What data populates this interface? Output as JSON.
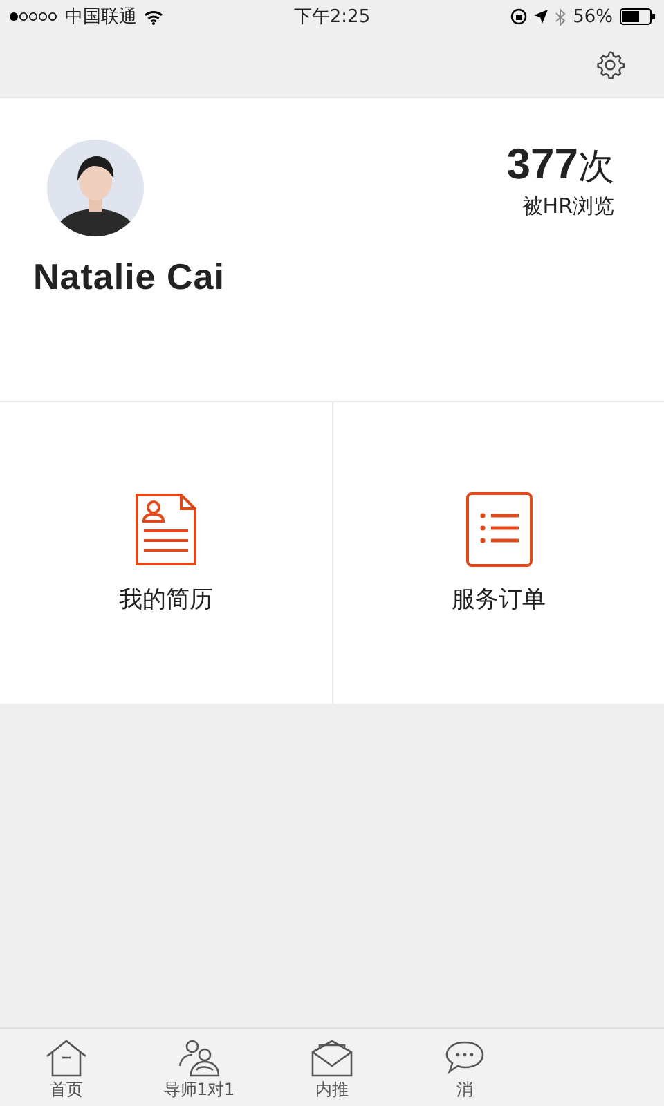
{
  "status_bar": {
    "carrier": "中国联通",
    "time": "下午2:25",
    "battery": "56%"
  },
  "profile": {
    "name": "Natalie Cai",
    "views": "377",
    "views_unit": "次",
    "views_label": "被HR浏览"
  },
  "menu": [
    {
      "kind": "resume",
      "label": "我的简历"
    },
    {
      "kind": "orders",
      "label": "服务订单"
    }
  ],
  "tabs": [
    {
      "kind": "home",
      "label": "首页",
      "selected": false
    },
    {
      "kind": "mentor",
      "label": "导师1对1",
      "selected": false
    },
    {
      "kind": "referral",
      "label": "内推",
      "selected": false
    },
    {
      "kind": "message",
      "label": "消",
      "selected": false
    }
  ]
}
